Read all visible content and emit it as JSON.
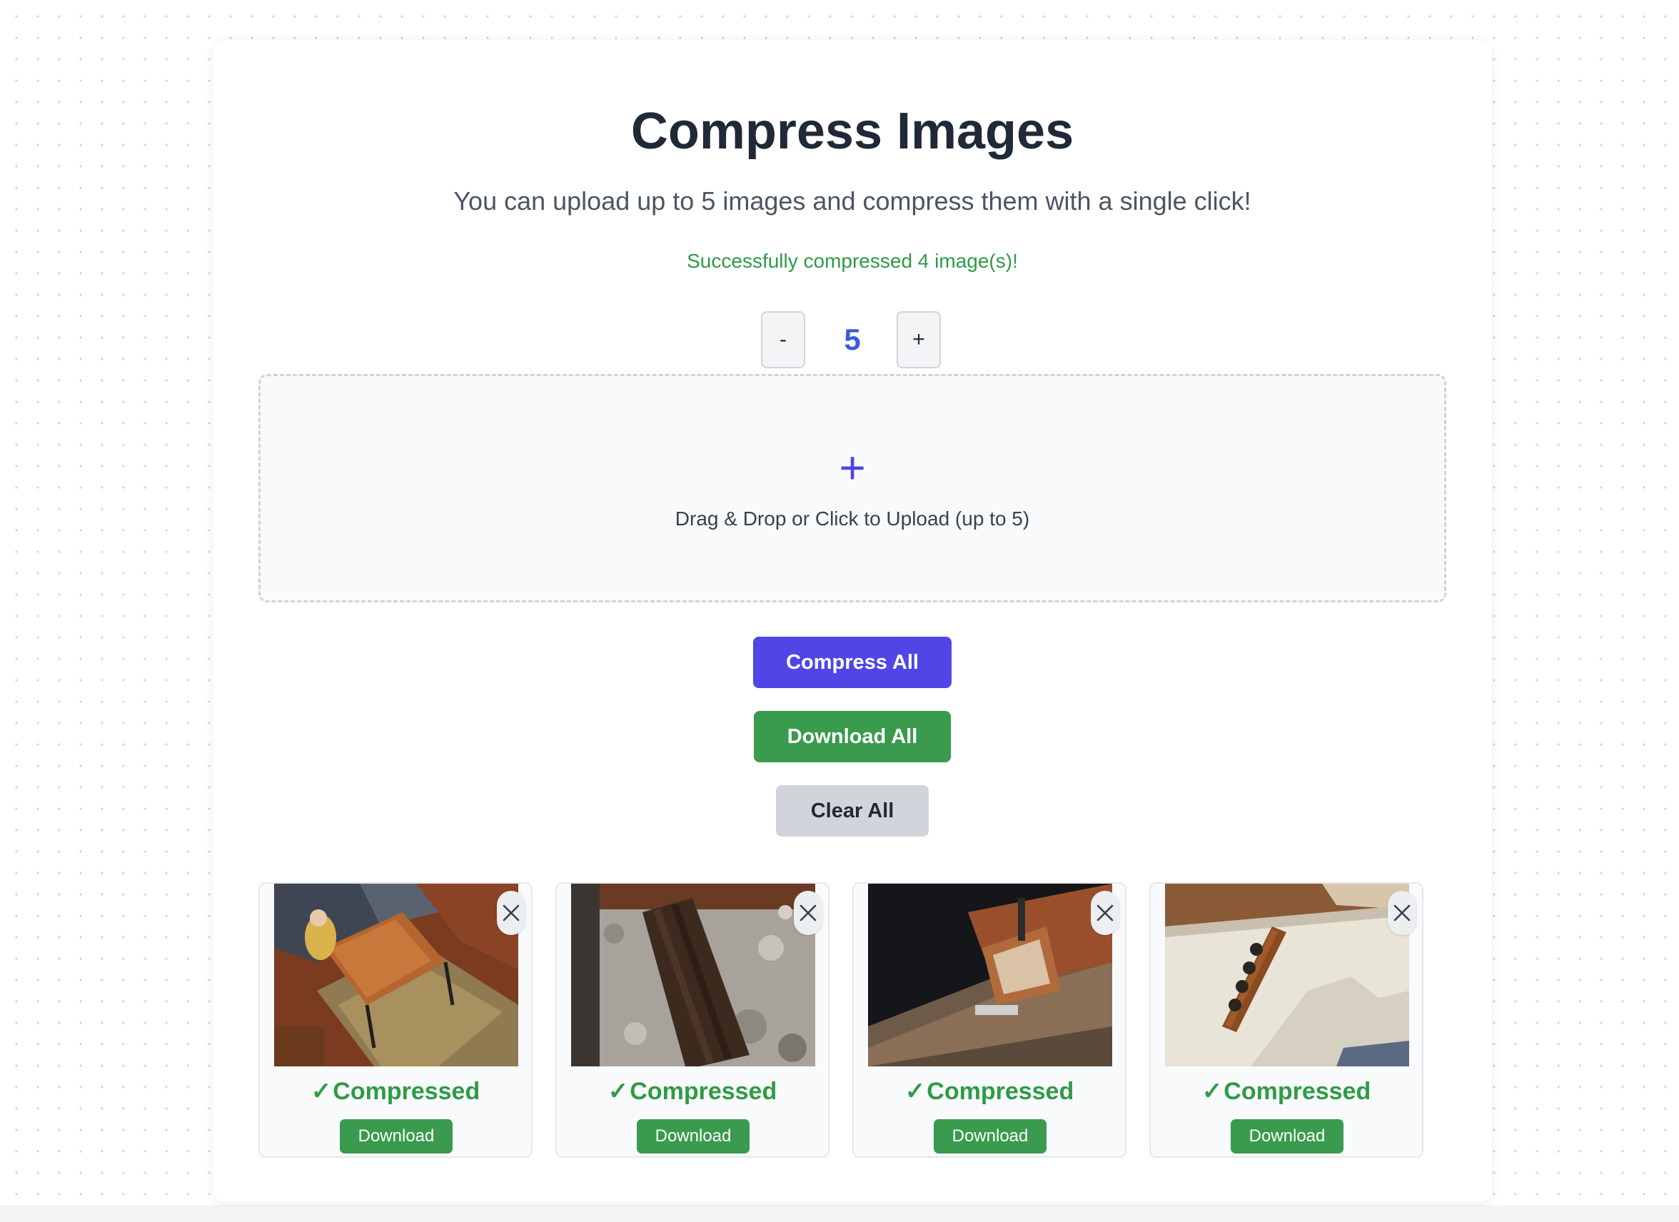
{
  "header": {
    "title": "Compress Images",
    "subtitle": "You can upload up to 5 images and compress them with a single click!",
    "status_message": "Successfully compressed 4 image(s)!"
  },
  "stepper": {
    "minus_label": "-",
    "value": "5",
    "plus_label": "+"
  },
  "dropzone": {
    "icon": "plus-icon",
    "plus_glyph": "+",
    "label": "Drag & Drop or Click to Upload (up to 5)"
  },
  "actions": {
    "compress_all": "Compress All",
    "download_all": "Download All",
    "clear_all": "Clear All"
  },
  "images": [
    {
      "status_check": "✓",
      "status": "Compressed",
      "download_label": "Download",
      "thumbnail": "table-on-rug-photo"
    },
    {
      "status_check": "✓",
      "status": "Compressed",
      "download_label": "Download",
      "thumbnail": "cutting-board-on-granite-photo"
    },
    {
      "status_check": "✓",
      "status": "Compressed",
      "download_label": "Download",
      "thumbnail": "wood-shelf-photo"
    },
    {
      "status_check": "✓",
      "status": "Compressed",
      "download_label": "Download",
      "thumbnail": "wall-hook-rack-photo"
    }
  ],
  "colors": {
    "accent": "#4f46e5",
    "success": "#3a9a4e",
    "stepper_value": "#3b5bdb",
    "neutral_button": "#d1d5db"
  }
}
